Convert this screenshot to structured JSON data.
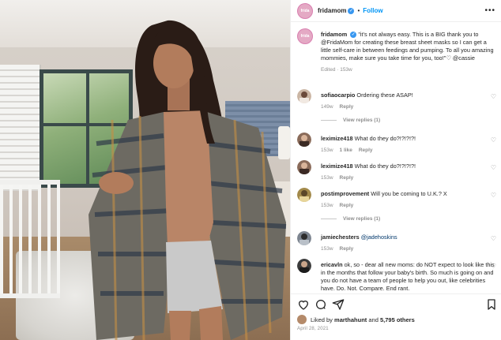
{
  "post": {
    "author": "fridamom",
    "avatar_text": "frida",
    "follow_label": "Follow",
    "separator": "•",
    "more_glyph": "•••",
    "caption_author": "fridamom",
    "caption_text": "\"it's not always easy. This is a BIG thank you to @FridaMom for creating these breast sheet masks so I can get a little self-care in between feedings and pumping. To all you amazing mommies, make sure you take time for you, too!\"♡ @cassie",
    "caption_meta": "Edited · 153w"
  },
  "comments": [
    {
      "user": "sofiaocarpio",
      "text": "Ordering these ASAP!",
      "time": "149w",
      "reply": "Reply",
      "replies": "View replies (1)"
    },
    {
      "user": "leximize418",
      "text": "What do they do?!?!?!?!",
      "time": "153w",
      "likes": "1 like",
      "reply": "Reply"
    },
    {
      "user": "leximize418",
      "text": "What do they do?!?!?!?!",
      "time": "153w",
      "reply": "Reply"
    },
    {
      "user": "postimprovement",
      "text": "Will you be coming to U.K.? X",
      "time": "153w",
      "reply": "Reply",
      "replies": "View replies (1)"
    },
    {
      "user": "jamiechesters",
      "text": "@jadehoskins",
      "time": "153w",
      "reply": "Reply"
    },
    {
      "user": "ericavln",
      "text": "ok, so - dear all new moms: do NOT expect to look like this in the months that follow your baby's birth. So much is going on and you do not have a team of people to help you out, like celebrities have. Do. Not. Compare. End rant.",
      "time": "",
      "reply": ""
    }
  ],
  "likes_line": {
    "prefix": "Liked by",
    "user": "marthahunt",
    "conj": "and",
    "count": "5,795 others"
  },
  "date": "April 28, 2021",
  "icons": [
    "heart-icon",
    "comment-icon",
    "share-icon",
    "bookmark-icon"
  ],
  "colors": {
    "link": "#0095f6",
    "muted": "#8e8e8e",
    "text": "#262626",
    "brand_avatar": "#e4a9c4"
  }
}
